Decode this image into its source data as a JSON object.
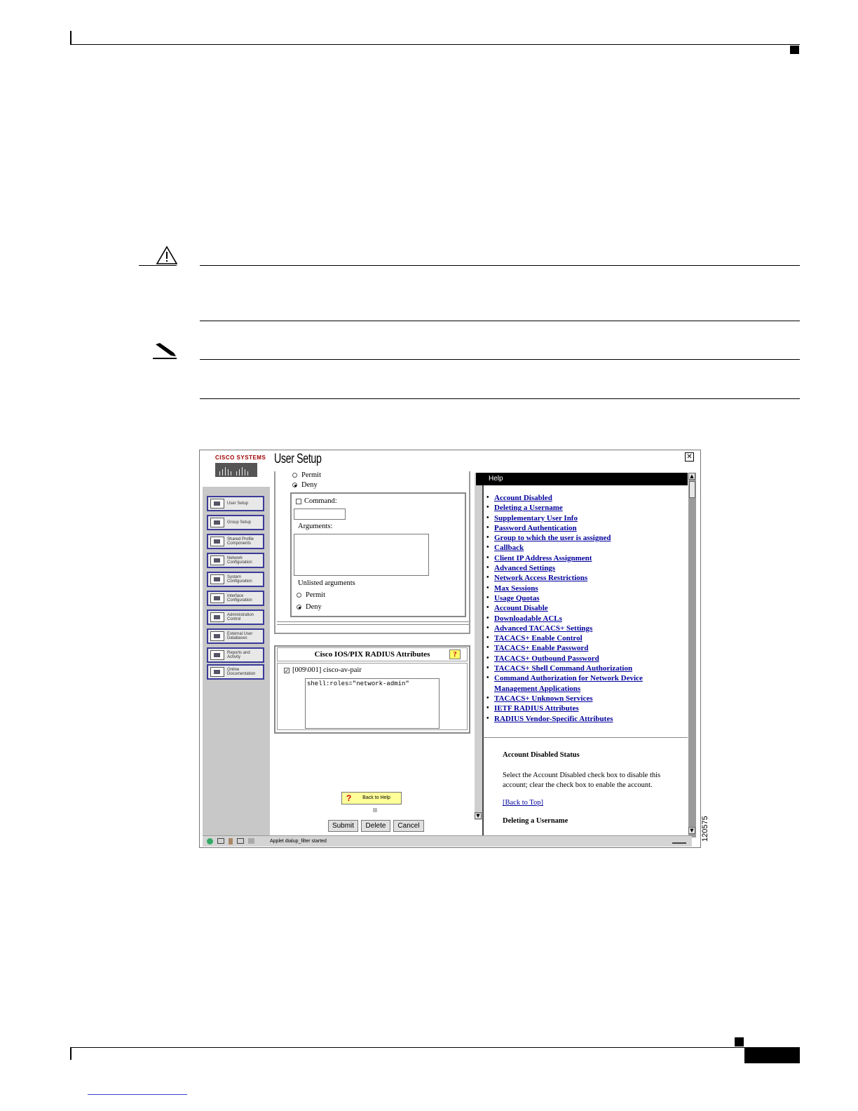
{
  "figure_number": "120575",
  "screenshot": {
    "logo_text": "CISCO SYSTEMS",
    "title": "User Setup",
    "nav_items": [
      {
        "label": "User Setup",
        "icon": "user-setup-icon"
      },
      {
        "label": "Group Setup",
        "icon": "group-setup-icon"
      },
      {
        "label": "Shared Profile Components",
        "icon": "shared-profile-icon"
      },
      {
        "label": "Network Configuration",
        "icon": "network-config-icon"
      },
      {
        "label": "System Configuration",
        "icon": "system-config-icon"
      },
      {
        "label": "Interface Configuration",
        "icon": "interface-config-icon"
      },
      {
        "label": "Administration Control",
        "icon": "admin-control-icon"
      },
      {
        "label": "External User Databases",
        "icon": "external-db-icon"
      },
      {
        "label": "Reports and Activity",
        "icon": "reports-icon"
      },
      {
        "label": "Online Documentation",
        "icon": "documentation-icon"
      }
    ],
    "form": {
      "permit_top": "Permit",
      "deny_top": "Deny",
      "command_label": "Command:",
      "arguments_label": "Arguments:",
      "unlisted_label": "Unlisted arguments",
      "permit": "Permit",
      "deny": "Deny",
      "radius_header": "Cisco IOS/PIX RADIUS Attributes",
      "av_pair_label": "[009\\001] cisco-av-pair",
      "av_pair_value": "shell:roles=\"network-admin\"",
      "back_to_help": "Back to Help",
      "submit": "Submit",
      "delete": "Delete",
      "cancel": "Cancel"
    },
    "help": {
      "header": "Help",
      "links": [
        "Account Disabled",
        "Deleting a Username",
        "Supplementary User Info",
        "Password Authentication",
        "Group to which the user is assigned",
        "Callback",
        "Client IP Address Assignment",
        "Advanced Settings",
        "Network Access Restrictions",
        "Max Sessions",
        "Usage Quotas",
        "Account Disable",
        "Downloadable ACLs",
        "Advanced TACACS+ Settings",
        "TACACS+ Enable Control",
        "TACACS+ Enable Password",
        "TACACS+ Outbound Password",
        "TACACS+ Shell Command Authorization",
        "Command Authorization for Network Device",
        "Management Applications",
        "TACACS+ Unknown Services",
        "IETF RADIUS Attributes",
        "RADIUS Vendor-Specific Attributes"
      ],
      "section1_title": "Account Disabled Status",
      "section1_body_line1": "Select the Account Disabled check box to disable this",
      "section1_body_line2": "account; clear the check box to enable the account.",
      "back_to_top": "[Back to Top]",
      "section2_title": "Deleting a Username"
    },
    "status_text": "Applet dialup_filter started"
  }
}
